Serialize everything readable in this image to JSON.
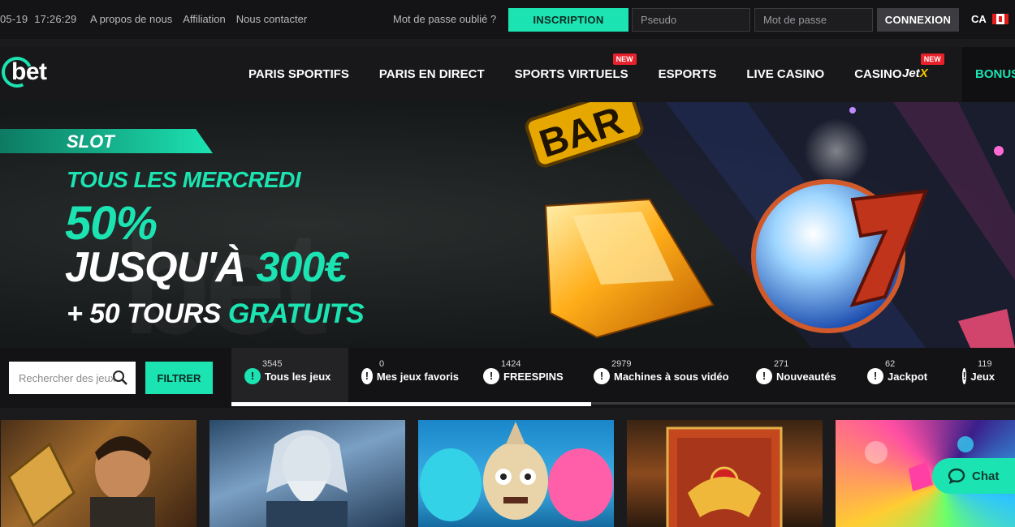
{
  "topbar": {
    "date": "05-19",
    "time": "17:26:29",
    "links": [
      "A propos de nous",
      "Affiliation",
      "Nous contacter"
    ],
    "forgot_password": "Mot de passe oublié ?",
    "register_label": "INSCRIPTION",
    "username_placeholder": "Pseudo",
    "password_placeholder": "Mot de passe",
    "login_label": "CONNEXION",
    "language": "CA"
  },
  "nav": {
    "logo_text": "bet",
    "items": [
      {
        "label": "PARIS SPORTIFS",
        "badge": ""
      },
      {
        "label": "PARIS EN DIRECT",
        "badge": ""
      },
      {
        "label": "SPORTS VIRTUELS",
        "badge": "NEW"
      },
      {
        "label": "ESPORTS",
        "badge": ""
      },
      {
        "label": "LIVE CASINO",
        "badge": ""
      },
      {
        "label": "CASINO",
        "badge": ""
      }
    ],
    "jetx": {
      "label_a": "Jet",
      "label_b": "X",
      "badge": "NEW"
    },
    "bonus_label": "BONUS"
  },
  "banner": {
    "tag": "SLOT",
    "line1": "TOUS LES MERCREDI",
    "line2": "50%",
    "line3_a": "JUSQU'À",
    "line3_b": "300€",
    "line4_a": "+ 50 TOURS",
    "line4_b": "GRATUITS"
  },
  "filter": {
    "search_placeholder": "Rechercher des jeux",
    "filter_label": "FILTRER",
    "categories": [
      {
        "label": "Tous les jeux",
        "count": "3545"
      },
      {
        "label": "Mes jeux favoris",
        "count": "0"
      },
      {
        "label": "FREESPINS",
        "count": "1424"
      },
      {
        "label": "Machines à sous vidéo",
        "count": "2979"
      },
      {
        "label": "Nouveautés",
        "count": "271"
      },
      {
        "label": "Jackpot",
        "count": "62"
      },
      {
        "label": "Jeux",
        "count": "119"
      }
    ]
  },
  "chat": {
    "label": "Chat"
  },
  "colors": {
    "accent": "#1ce3b2",
    "badge": "#e8212c",
    "background": "#1b1b1d"
  }
}
